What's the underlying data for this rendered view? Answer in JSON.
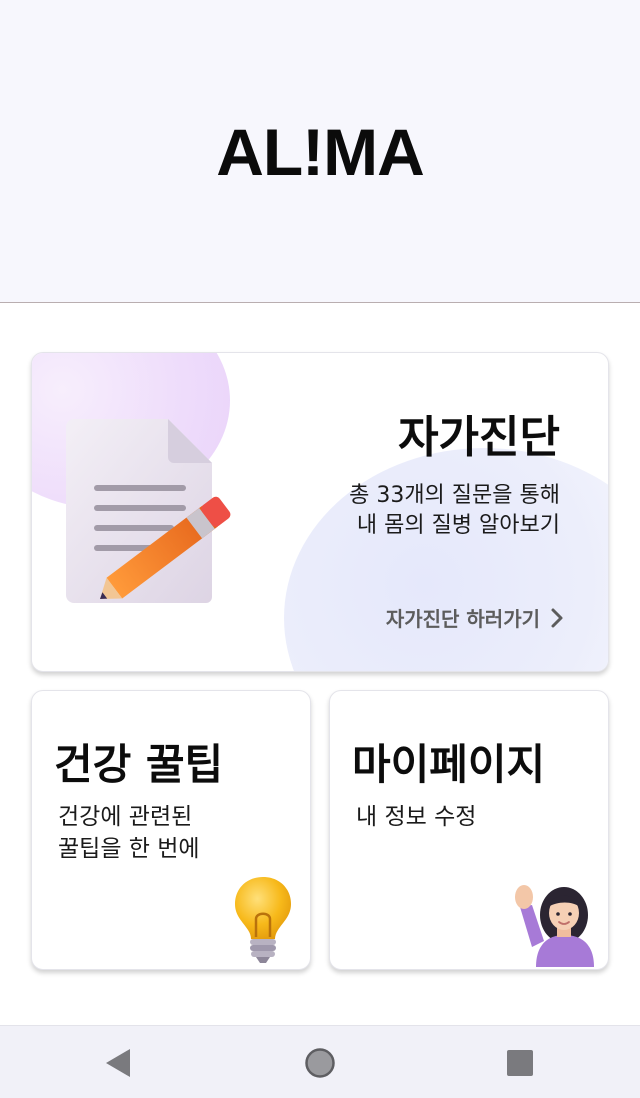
{
  "app": {
    "logo": "AL!MA"
  },
  "cards": {
    "self_diagnosis": {
      "title": "자가진단",
      "desc_line1": "총 33개의 질문을 통해",
      "desc_line2": "내 몸의 질병 알아보기",
      "link_label": "자가진단 하러가기",
      "icon": "document-pencil-icon"
    },
    "health_tips": {
      "title": "건강 꿀팁",
      "desc_line1": "건강에 관련된",
      "desc_line2": "꿀팁을 한 번에",
      "icon": "light-bulb-icon"
    },
    "my_page": {
      "title": "마이페이지",
      "desc_line1": "내 정보 수정",
      "icon": "waving-person-icon"
    }
  },
  "navbar": {
    "back_icon": "back-triangle-icon",
    "home_icon": "home-circle-icon",
    "recent_icon": "recent-apps-square-icon"
  },
  "colors": {
    "header_bg": "#f7f7fd",
    "navbar_bg": "#f1f1f8",
    "link_text": "#5c5c5c",
    "pencil_orange": "#f37a22",
    "bulb_yellow": "#f7b91a",
    "shirt_purple": "#a77ad7"
  }
}
